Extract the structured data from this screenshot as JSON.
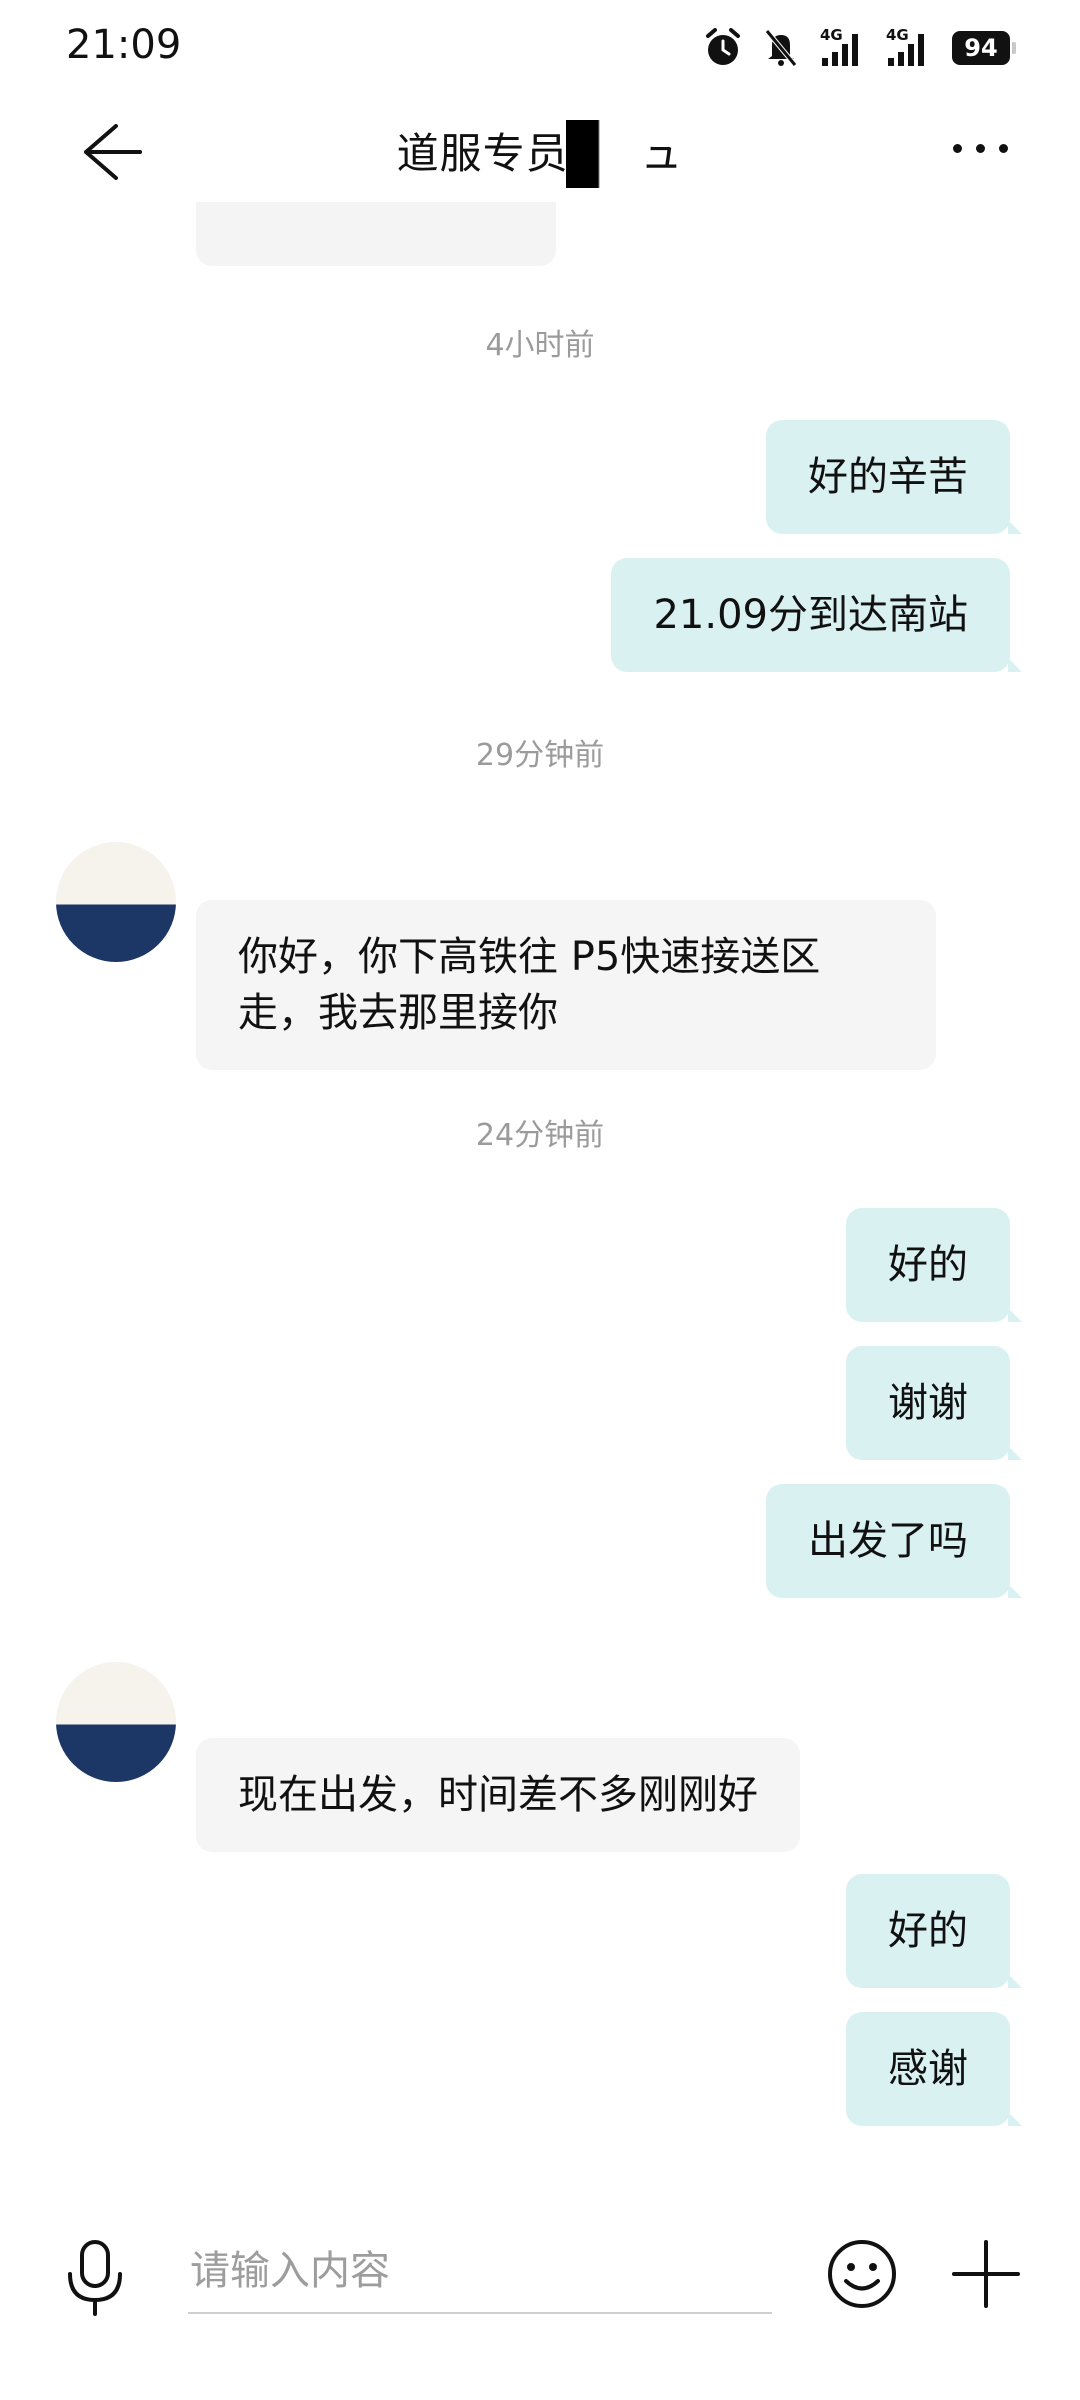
{
  "status_bar": {
    "time": "21:09",
    "network_1": "4G",
    "network_2": "4G",
    "battery": "94",
    "icons": [
      "alarm-icon",
      "mute-icon",
      "signal-icon",
      "signal-icon",
      "battery-icon"
    ]
  },
  "header": {
    "title": "道服专员 钅         ュ",
    "back_icon": "back-arrow-icon",
    "more_icon": "more-icon"
  },
  "messages": [
    {
      "type": "time",
      "text": "4小时前"
    },
    {
      "type": "out",
      "text": "好的辛苦"
    },
    {
      "type": "out",
      "text": "21.09分到达南站"
    },
    {
      "type": "time",
      "text": "29分钟前"
    },
    {
      "type": "in",
      "text": "你好，你下高铁往 P5快速接送区走，我去那里接你"
    },
    {
      "type": "time",
      "text": "24分钟前"
    },
    {
      "type": "out",
      "text": "好的"
    },
    {
      "type": "out",
      "text": "谢谢"
    },
    {
      "type": "out",
      "text": "出发了吗"
    },
    {
      "type": "in",
      "text": "现在出发，时间差不多刚刚好"
    },
    {
      "type": "out",
      "text": "好的"
    },
    {
      "type": "out",
      "text": "感谢"
    }
  ],
  "input_bar": {
    "placeholder": "请输入内容",
    "icons": [
      "microphone-icon",
      "emoji-icon",
      "plus-icon"
    ]
  },
  "colors": {
    "outgoing_bubble": "#daf1f2",
    "incoming_bubble": "#f5f5f5",
    "timestamp_text": "#9b9b9b",
    "avatar_dark": "#1c3766"
  }
}
